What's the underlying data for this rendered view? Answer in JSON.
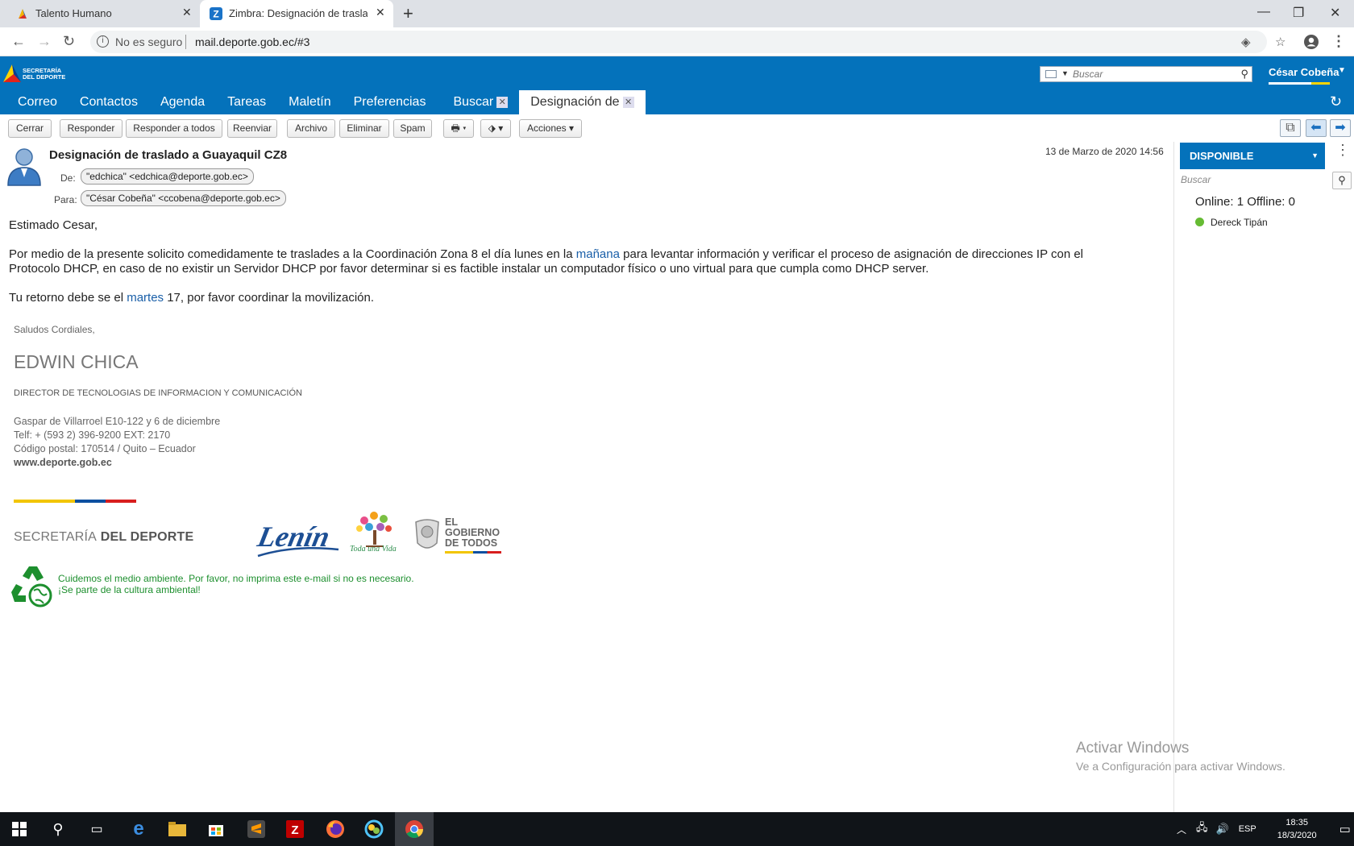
{
  "browser": {
    "tabs": [
      {
        "title": "Talento Humano"
      },
      {
        "title": "Zimbra: Designación de traslado"
      }
    ],
    "security": "No es seguro",
    "url": "mail.deporte.gob.ec/#3"
  },
  "zimbra": {
    "logo": {
      "line1": "SECRETARÍA",
      "line2": "DEL DEPORTE"
    },
    "search_placeholder": "Buscar",
    "user": "César Cobeña",
    "apps": [
      "Correo",
      "Contactos",
      "Agenda",
      "Tareas",
      "Maletín",
      "Preferencias"
    ],
    "app_tabs": [
      {
        "label": "Buscar"
      },
      {
        "label": "Designación de"
      }
    ]
  },
  "toolbar": {
    "close": "Cerrar",
    "reply": "Responder",
    "reply_all": "Responder a todos",
    "forward": "Reenviar",
    "archive": "Archivo",
    "delete": "Eliminar",
    "spam": "Spam",
    "actions": "Acciones"
  },
  "message": {
    "subject": "Designación de traslado a Guayaquil CZ8",
    "date": "13 de Marzo de 2020 14:56",
    "from_label": "De:",
    "from": "\"edchica\" <edchica@deporte.gob.ec>",
    "to_label": "Para:",
    "to": "\"César Cobeña\" <ccobena@deporte.gob.ec>",
    "greeting": "Estimado Cesar,",
    "p1_a": "Por medio de la presente solicito comedidamente te traslades a la Coordinación Zona 8 el día lunes en la ",
    "p1_link": "mañana",
    "p1_b": " para levantar información y verificar el proceso de asignación de direcciones IP con el",
    "p1_c": "Protocolo DHCP, en caso de no existir un Servidor DHCP por favor determinar si es factible instalar un computador físico o uno virtual para que cumpla como DHCP server.",
    "p2_a": "Tu retorno debe se el ",
    "p2_link": "martes",
    "p2_b": " 17, por favor coordinar la movilización.",
    "signature": {
      "salute": "Saludos Cordiales,",
      "name": "EDWIN CHICA",
      "title": "DIRECTOR DE TECNOLOGIAS DE INFORMACION Y COMUNICACIÓN",
      "address": "Gaspar de Villarroel E10-122 y 6 de diciembre",
      "phone": "Telf: + (593 2) 396-9200 EXT: 2170",
      "postal": "Código postal: 170514 / Quito – Ecuador",
      "web": "www.deporte.gob.ec",
      "org_a": "SECRETARÍA",
      "org_b": " DEL DEPORTE",
      "slogan": "Toda una Vida",
      "gov1": "EL",
      "gov2": "GOBIERNO",
      "gov3": "DE TODOS",
      "eco1": "Cuidemos el medio ambiente. Por favor, no imprima este e-mail si no es necesario.",
      "eco2": "¡Se parte de la cultura ambiental!"
    }
  },
  "chat": {
    "status": "DISPONIBLE",
    "search_placeholder": "Buscar",
    "summary": "Online: 1 Offline: 0",
    "buddies": [
      "Dereck Tipán"
    ]
  },
  "watermark": {
    "title": "Activar Windows",
    "subtitle": "Ve a Configuración para activar Windows."
  },
  "taskbar": {
    "lang": "ESP",
    "time": "18:35",
    "date": "18/3/2020"
  },
  "colors": {
    "zimbra_blue": "#0472bb",
    "link": "#1a5fa8",
    "eco_green": "#1d8f2e"
  }
}
